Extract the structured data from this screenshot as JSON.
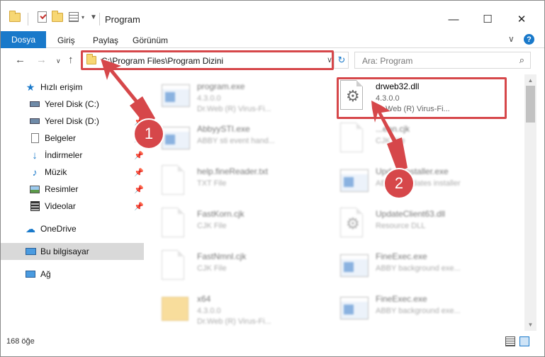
{
  "window": {
    "title": "Program"
  },
  "ribbon": {
    "tabs": [
      "Dosya",
      "Giriş",
      "Paylaş",
      "Görünüm"
    ]
  },
  "address": {
    "path": "C:\\Program Files\\Program Dizini"
  },
  "search": {
    "placeholder": "Ara: Program"
  },
  "sidebar": {
    "quick_access": "Hızlı erişim",
    "items": [
      {
        "label": "Yerel Disk (C:)",
        "icon": "drive-icon",
        "pinned": true
      },
      {
        "label": "Yerel Disk (D:)",
        "icon": "drive-icon",
        "pinned": true
      },
      {
        "label": "Belgeler",
        "icon": "documents-icon",
        "pinned": true
      },
      {
        "label": "İndirmeler",
        "icon": "download-icon",
        "pinned": true
      },
      {
        "label": "Müzik",
        "icon": "music-icon",
        "pinned": true
      },
      {
        "label": "Resimler",
        "icon": "pictures-icon",
        "pinned": true
      },
      {
        "label": "Videolar",
        "icon": "videos-icon",
        "pinned": true
      }
    ],
    "onedrive": "OneDrive",
    "this_pc": "Bu bilgisayar",
    "network": "Ağ"
  },
  "files": [
    {
      "name": "program.exe",
      "line2": "4.3.0.0",
      "line3": "Dr.Web (R) Virus-Fi...",
      "type": "exe"
    },
    {
      "name": "drweb32.dll",
      "line2": "4.3.0.0",
      "line3": "Dr.Web (R) Virus-Fi...",
      "type": "dll",
      "highlight": true
    },
    {
      "name": "AbbyySTI.exe",
      "line2": "ABBY sti event hand...",
      "line3": "",
      "type": "exe"
    },
    {
      "name": "...ean.cjk",
      "line2": "CJK File",
      "line3": "",
      "type": "doc"
    },
    {
      "name": "help.fineReader.txt",
      "line2": "TXT File",
      "line3": "",
      "type": "doc"
    },
    {
      "name": "UpdateInstaller.exe",
      "line2": "ABBYY updates installer",
      "line3": "",
      "type": "exe"
    },
    {
      "name": "FastKorn.cjk",
      "line2": "CJK File",
      "line3": "",
      "type": "doc"
    },
    {
      "name": "UpdateClient63.dll",
      "line2": "Resource DLL",
      "line3": "",
      "type": "dll"
    },
    {
      "name": "FastNmnl.cjk",
      "line2": "CJK File",
      "line3": "",
      "type": "doc"
    },
    {
      "name": "FineExec.exe",
      "line2": "ABBY background exe...",
      "line3": "",
      "type": "exe"
    },
    {
      "name": "x64",
      "line2": "4.3.0.0",
      "line3": "Dr.Web (R) Virus-Fi...",
      "type": "folder"
    },
    {
      "name": "FineExec.exe",
      "line2": "ABBY background exe...",
      "line3": "",
      "type": "exe"
    }
  ],
  "status": {
    "count": "168 öğe"
  },
  "annotations": {
    "badge1": "1",
    "badge2": "2"
  },
  "colors": {
    "accent": "#1979ca",
    "annotation": "#d6474a"
  }
}
